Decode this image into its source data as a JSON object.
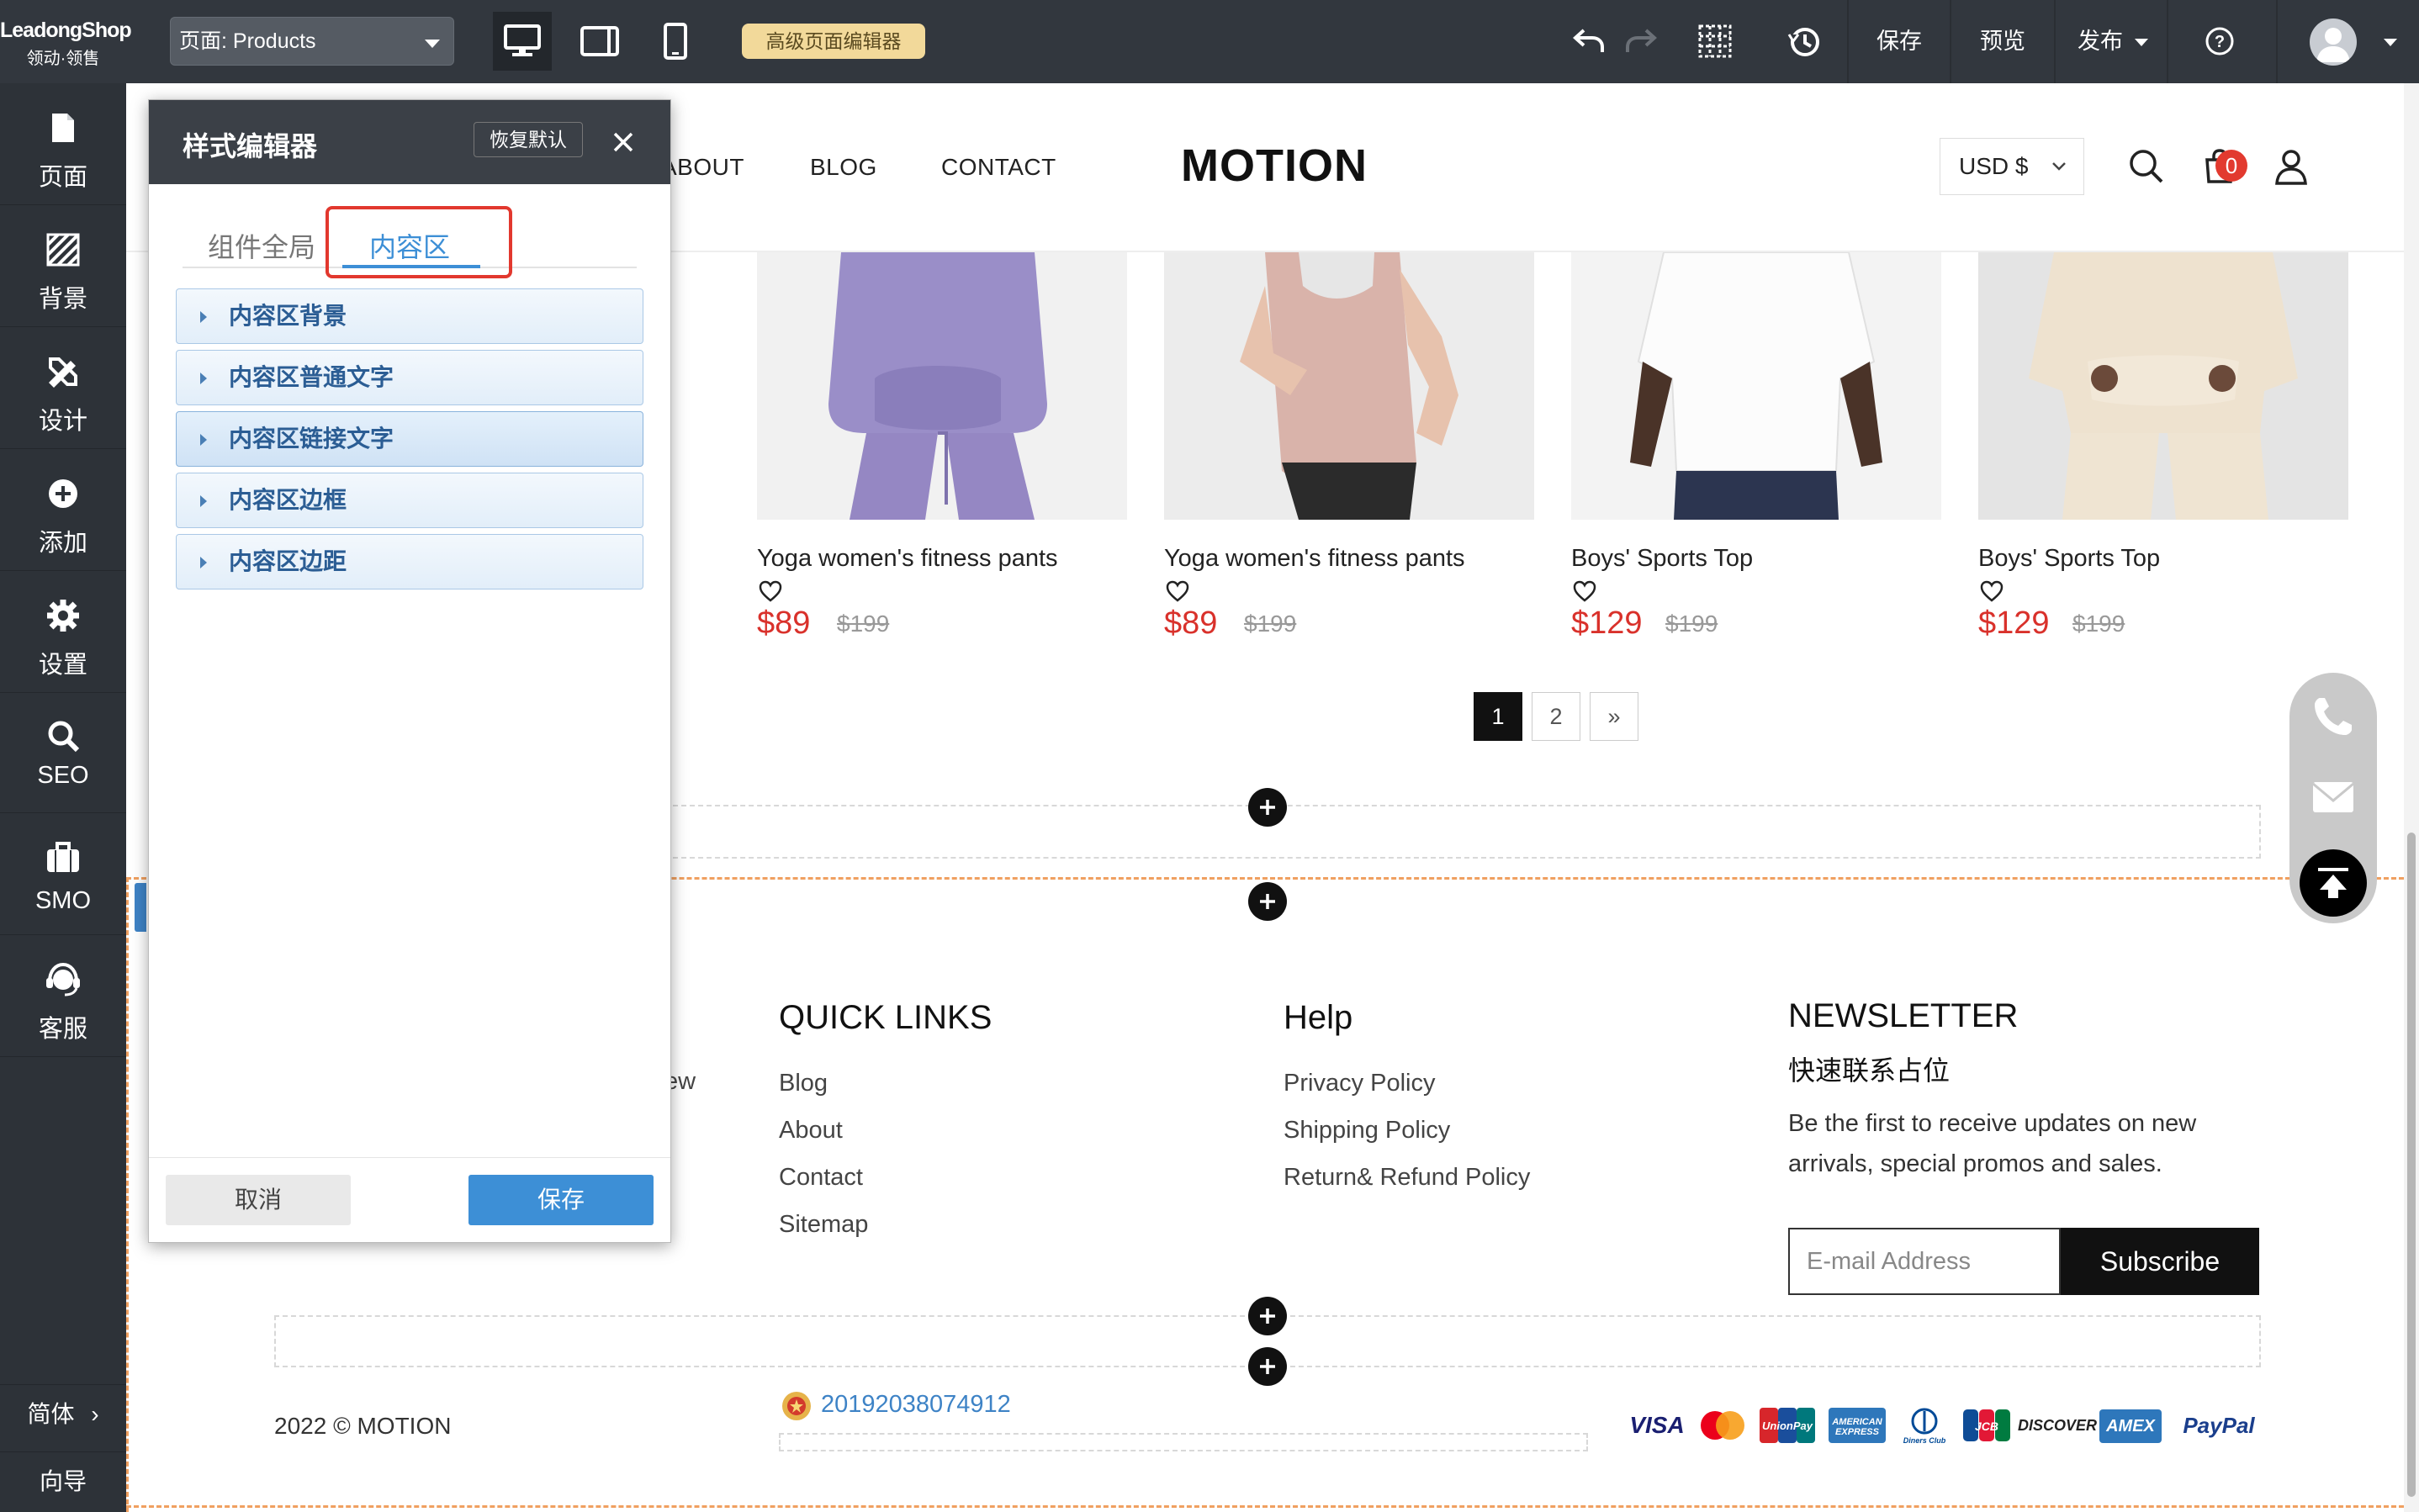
{
  "toolbar": {
    "logo_line1": "LeadongShop",
    "logo_line2": "领动·领售",
    "page_select_value": "页面: Products",
    "advanced_editor_label": "高级页面编辑器",
    "save_label": "保存",
    "preview_label": "预览",
    "publish_label": "发布",
    "icons": [
      "desktop-icon",
      "tablet-icon",
      "mobile-icon",
      "undo-icon",
      "redo-icon",
      "grid-icon",
      "history-icon",
      "help-icon",
      "avatar-icon"
    ]
  },
  "sidebar": {
    "items": [
      {
        "label": "页面",
        "icon": "page-icon"
      },
      {
        "label": "背景",
        "icon": "background-icon"
      },
      {
        "label": "设计",
        "icon": "design-icon"
      },
      {
        "label": "添加",
        "icon": "add-icon"
      },
      {
        "label": "设置",
        "icon": "settings-icon"
      },
      {
        "label": "SEO",
        "icon": "search-icon"
      },
      {
        "label": "SMO",
        "icon": "briefcase-icon"
      },
      {
        "label": "客服",
        "icon": "headset-icon"
      }
    ],
    "language_label": "简体",
    "guide_label": "向导"
  },
  "site": {
    "nav": {
      "about": "ABOUT",
      "blog": "BLOG",
      "contact": "CONTACT"
    },
    "brand": "MOTION",
    "currency": "USD $",
    "cart_count": "0",
    "products": [
      {
        "name": "Yoga women's fitness pants",
        "price": "$89",
        "old_price": "$199",
        "image": "lavender-tracksuit"
      },
      {
        "name": "Yoga women's fitness pants",
        "price": "$89",
        "old_price": "$199",
        "image": "pink-tank-top"
      },
      {
        "name": "Boys' Sports Top",
        "price": "$129",
        "old_price": "$199",
        "image": "white-tshirt"
      },
      {
        "name": "Boys' Sports Top",
        "price": "$129",
        "old_price": "$199",
        "image": "cream-sweatsuit"
      }
    ],
    "pagination": {
      "pages": [
        "1",
        "2"
      ],
      "next": "»",
      "current": "1"
    },
    "footer": {
      "partial_text": "ew",
      "quick_links": {
        "title": "QUICK LINKS",
        "items": [
          "Blog",
          "About",
          "Contact",
          "Sitemap"
        ]
      },
      "help": {
        "title": "Help",
        "items": [
          "Privacy Policy",
          "Shipping Policy",
          "Return& Refund Policy"
        ]
      },
      "newsletter": {
        "title": "NEWSLETTER",
        "subtitle": "快速联系占位",
        "description": "Be the first to receive updates on new arrivals, special promos and sales.",
        "email_placeholder": "E-mail Address",
        "subscribe_label": "Subscribe"
      },
      "copyright": "2022 © MOTION",
      "icp": "20192038074912",
      "payments": [
        "VISA",
        "MasterCard",
        "UnionPay",
        "AMERICAN EXPRESS",
        "Diners Club",
        "JCB",
        "DISCOVER",
        "AMEX",
        "PayPal"
      ]
    }
  },
  "style_editor": {
    "title": "样式编辑器",
    "reset_label": "恢复默认",
    "tabs": [
      "组件全局",
      "内容区"
    ],
    "active_tab": "内容区",
    "sections": [
      "内容区背景",
      "内容区普通文字",
      "内容区链接文字",
      "内容区边框",
      "内容区边距"
    ],
    "active_section": "内容区链接文字",
    "cancel_label": "取消",
    "save_label": "保存"
  },
  "colors": {
    "toolbar_bg": "#32373e",
    "sidebar_bg": "#2d3238",
    "accent_blue": "#3d8fd6",
    "price_red": "#d9312b",
    "highlight_red": "#e2382e",
    "advanced_badge": "#f2d99a"
  }
}
